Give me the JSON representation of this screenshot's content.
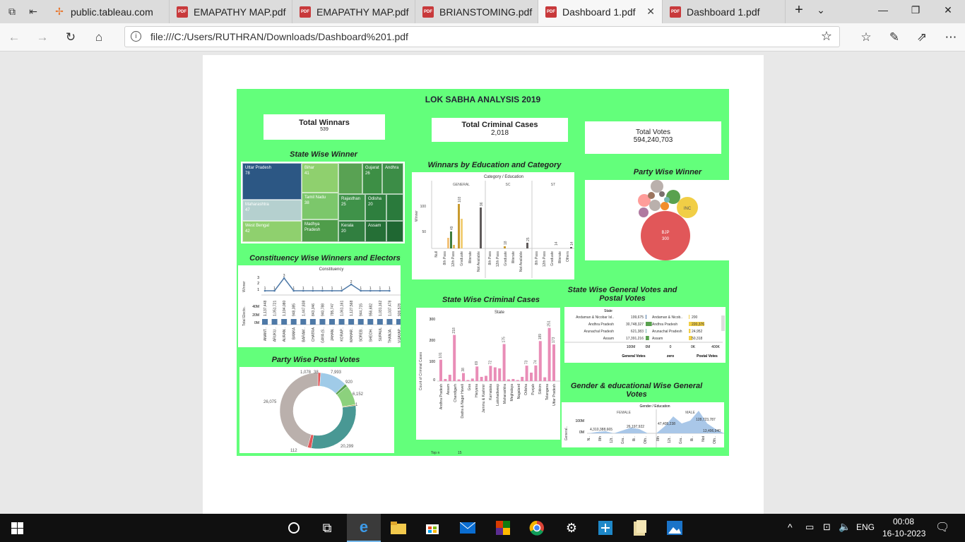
{
  "browser": {
    "tabs": [
      {
        "label": "public.tableau.com",
        "icon": "tableau-icon"
      },
      {
        "label": "EMAPATHY MAP.pdf",
        "icon": "pdf-icon"
      },
      {
        "label": "EMAPATHY MAP.pdf",
        "icon": "pdf-icon"
      },
      {
        "label": "BRIANSTOMING.pdf",
        "icon": "pdf-icon"
      },
      {
        "label": "Dashboard 1.pdf",
        "icon": "pdf-icon",
        "active": true
      },
      {
        "label": "Dashboard 1.pdf",
        "icon": "pdf-icon"
      }
    ],
    "pdf_icon_text": "PDF",
    "address": "file:///C:/Users/RUTHRAN/Downloads/Dashboard%201.pdf"
  },
  "dashboard": {
    "title": "LOK SABHA ANALYSIS 2019",
    "kpis": {
      "winners_label": "Total Winnars",
      "winners_value": "539",
      "cases_label": "Total Criminal Cases",
      "cases_value": "2,018",
      "votes_label": "Total Votes",
      "votes_value": "594,240,703"
    },
    "sections": {
      "state_winner": "State Wise Winner",
      "education": "Winnars by Education and Category",
      "party_winner": "Party Wise Winner",
      "constituency": "Constituency Wise Winners and Electors",
      "criminal": "State Wise Criminal Cases",
      "gen_postal": "State Wise General Votes and Postal Votes",
      "postal": "Party Wise Postal Votes",
      "gender": "Gender & educational Wise General Votes"
    },
    "footer": {
      "label": "Top n",
      "value": "15"
    }
  },
  "treemap": [
    {
      "name": "Uttar Pradesh",
      "value": "78"
    },
    {
      "name": "Bihar",
      "value": "41"
    },
    {
      "name": "Gujarat",
      "value": "26"
    },
    {
      "name": "Andhra",
      "value": ""
    },
    {
      "name": "Maharashtra",
      "value": "47"
    },
    {
      "name": "Tamil Nadu",
      "value": "38"
    },
    {
      "name": "Rajasthan",
      "value": "25"
    },
    {
      "name": "Odisha",
      "value": "20"
    },
    {
      "name": "West Bengal",
      "value": "42"
    },
    {
      "name": "Madhya Pradesh",
      "value": ""
    },
    {
      "name": "Kerala",
      "value": "20"
    },
    {
      "name": "Assam",
      "value": ""
    }
  ],
  "education_chart": {
    "header": "Category / Education",
    "groups": [
      "GENERAL",
      "SC",
      "ST"
    ],
    "ylabel": "Winner",
    "yticks": [
      "100",
      "50"
    ],
    "labels": [
      "49",
      "103",
      "96",
      "18",
      "25",
      "14",
      "14"
    ],
    "xlabels_general": [
      "Null",
      "8th Pass",
      "12th Pass",
      "Graduate",
      "Illiterate",
      "Not Available"
    ],
    "xlabels_sc": [
      "8th Pass",
      "12th Pass",
      "Graduate",
      "Illiterate",
      "Not Available"
    ],
    "xlabels_st": [
      "8th Pass",
      "12th Pass",
      "Graduate",
      "Illiterate",
      "Others"
    ]
  },
  "party_bubbles": {
    "bjp_label": "BJP",
    "bjp_value": "300",
    "inc_label": "INC"
  },
  "constituency_chart": {
    "header": "Constituency",
    "ylabel_top": "Winner",
    "ylabel_bottom": "Total Electo..",
    "winner_ticks": [
      "3",
      "2",
      "1"
    ],
    "elector_ticks": [
      "40M",
      "20M",
      "0M"
    ],
    "winner_values": [
      "1",
      "1",
      "3",
      "1",
      "1",
      "1",
      "1",
      "1",
      "1",
      "2",
      "1",
      "1",
      "1",
      "1"
    ],
    "elector_labels": [
      "1,137,448",
      "1,051,721",
      "1,194,080",
      "948,385",
      "1,447,838",
      "843,346",
      "940,788",
      "795,747",
      "1,061,161",
      "1,127,568",
      "944,715",
      "956,682",
      "1,031,162",
      "1,037,478",
      "926,578"
    ],
    "x_labels": [
      "ANANT..",
      "ARUKU..",
      "AURAN..",
      "BANKA",
      "BARAM..",
      "CHATRA",
      "GAYA (S..",
      "JAHAN..",
      "KORAP..",
      "MAHAR..",
      "SOREB..",
      "SHEOH..",
      "SUPAUL",
      "THANJA..",
      "VIJAYAP.."
    ]
  },
  "criminal_chart": {
    "header": "State",
    "ylabel": "Count of Criminal Cases",
    "yticks": [
      "300",
      "200",
      "100",
      "0"
    ],
    "value_labels": [
      "101",
      "218",
      "38",
      "69",
      "72",
      "175",
      "73",
      "74",
      "189",
      "251",
      "173"
    ],
    "states": [
      "Andhra Pradesh",
      "Assam",
      "Chandigarh",
      "Dadra & Nagar Haveli",
      "Goa",
      "Haryana",
      "Jammu & Kashmir",
      "Karnataka",
      "Lakshadweep",
      "Maharashtra",
      "Meghalaya",
      "Nagaland",
      "Odisha",
      "Punjab",
      "Sikkim",
      "Telangana",
      "Uttar Pradesh"
    ]
  },
  "gen_postal_table": {
    "header": "State",
    "rows": [
      {
        "state": "Andaman & Nicobar Isl..",
        "general": "199,675",
        "state2": "Andaman & Nicob..",
        "postal": "200"
      },
      {
        "state": "Andhra Pradesh",
        "general": "30,748,327",
        "state2": "Andhra Pradesh",
        "postal": "220,376"
      },
      {
        "state": "Arunachal Pradesh",
        "general": "621,383",
        "state2": "Arunachal Pradesh",
        "postal": "24,952"
      },
      {
        "state": "Assam",
        "general": "17,391,216",
        "state2": "Assam",
        "postal": "50,318"
      }
    ],
    "axis1": [
      "100M",
      "0M"
    ],
    "axis2": [
      "0"
    ],
    "axis3": [
      "0K",
      "400K"
    ],
    "cols": [
      "General Votes",
      "zero",
      "Postal Votes"
    ]
  },
  "postal_donut": {
    "labels": [
      "1,078",
      "38",
      "7,993",
      "920",
      "6,152",
      "20,299",
      "112",
      "26,075",
      "1"
    ]
  },
  "gender_chart": {
    "header": "Gender / Education",
    "groups": [
      "FEMALE",
      "MALE"
    ],
    "ylabel": "General..",
    "yticks": [
      "100M",
      "0M"
    ],
    "labels": [
      "4,310,388,665",
      "26,197,922",
      "47,405,238",
      "128,723,787",
      "13,496,940"
    ],
    "xlabels": [
      "N..",
      "8th",
      "12t..",
      "Gra..",
      "Illi..",
      "Oth..",
      "8th",
      "12t..",
      "Gra..",
      "Illi..",
      "Not",
      "Oth.."
    ]
  },
  "taskbar": {
    "language": "ENG",
    "time": "00:08",
    "date": "16-10-2023"
  },
  "colors": {
    "dashboard_bg": "#63ff7b",
    "bjp": "#e15759",
    "inc": "#f1ce46",
    "treemap_blue": "#2c5784",
    "bar_blue": "#4e79a7",
    "criminal_pink": "#e98db7"
  }
}
